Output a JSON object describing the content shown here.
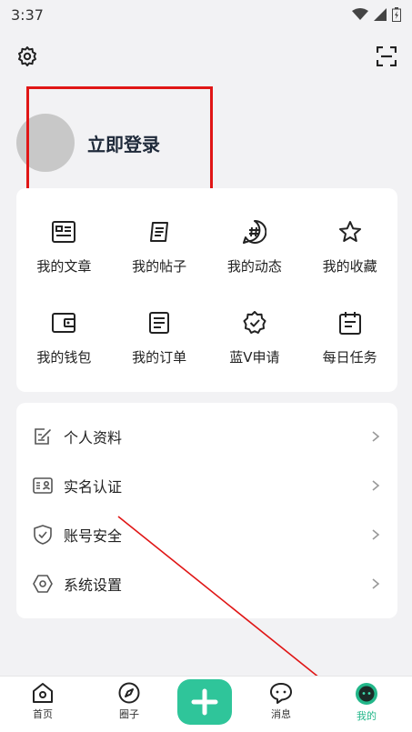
{
  "status_bar": {
    "time": "3:37"
  },
  "icons": {
    "settings": "gear-icon",
    "scan": "scan-icon"
  },
  "profile": {
    "login_label": "立即登录"
  },
  "grid": {
    "items": [
      {
        "label": "我的文章",
        "icon": "article-icon"
      },
      {
        "label": "我的帖子",
        "icon": "post-icon"
      },
      {
        "label": "我的动态",
        "icon": "hashtag-icon"
      },
      {
        "label": "我的收藏",
        "icon": "star-icon"
      },
      {
        "label": "我的钱包",
        "icon": "wallet-icon"
      },
      {
        "label": "我的订单",
        "icon": "order-icon"
      },
      {
        "label": "蓝V申请",
        "icon": "verified-badge-icon"
      },
      {
        "label": "每日任务",
        "icon": "calendar-task-icon"
      }
    ]
  },
  "menu": {
    "items": [
      {
        "label": "个人资料",
        "icon": "edit-profile-icon"
      },
      {
        "label": "实名认证",
        "icon": "id-card-icon"
      },
      {
        "label": "账号安全",
        "icon": "shield-icon"
      },
      {
        "label": "系统设置",
        "icon": "hex-settings-icon"
      }
    ]
  },
  "tab_bar": {
    "tabs": [
      {
        "label": "首页",
        "icon": "home-icon"
      },
      {
        "label": "圈子",
        "icon": "compass-icon"
      },
      {
        "label": "消息",
        "icon": "chat-icon"
      },
      {
        "label": "我的",
        "icon": "mine-icon"
      }
    ],
    "active_tab": "我的",
    "fab_icon": "plus-icon"
  },
  "colors": {
    "accent": "#23b78a",
    "annotation_red": "#e01616",
    "background": "#f2f2f4"
  }
}
